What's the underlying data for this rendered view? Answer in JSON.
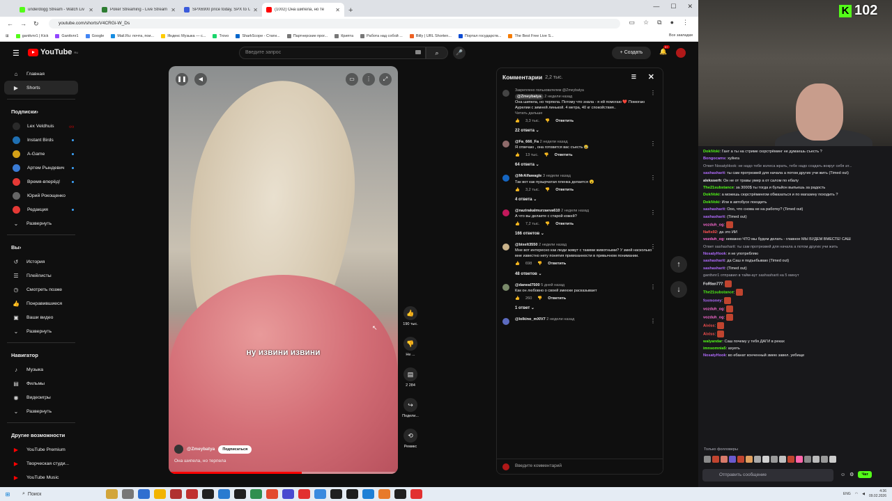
{
  "browser": {
    "tabs": [
      {
        "label": "underdogg Stream - Watch Liv",
        "color": "#53fc18",
        "active": false
      },
      {
        "label": "Poker Streaming - Live Stream",
        "color": "#2e7d32",
        "active": false
      },
      {
        "label": "SPX6900 price today, SPX to U",
        "color": "#3b5bdb",
        "active": false
      },
      {
        "label": "(1002) Она шипела, но те",
        "color": "#ff0000",
        "active": true
      }
    ],
    "url": "youtube.com/shorts/V4CRGi-W_Ds",
    "bookmarks": [
      {
        "label": "ganttvnr1 | Kick",
        "color": "#53fc18"
      },
      {
        "label": "Ganttvnr1",
        "color": "#9146ff"
      },
      {
        "label": "Google",
        "color": "#4285f4"
      },
      {
        "label": "Mail.Ru: почта, пои...",
        "color": "#168de2"
      },
      {
        "label": "Яндекс Музыка — с...",
        "color": "#ffcc00"
      },
      {
        "label": "Trovo",
        "color": "#19d66b"
      },
      {
        "label": "SharkScope - Стати...",
        "color": "#0066cc"
      },
      {
        "label": "Партнерские прог...",
        "color": "#777777"
      },
      {
        "label": "Крипта",
        "color": "#777777"
      },
      {
        "label": "Работа над собой ...",
        "color": "#777777"
      },
      {
        "label": "Bitly | URL Shorten...",
        "color": "#ee6123"
      },
      {
        "label": "Портал государств...",
        "color": "#0d4cd3"
      },
      {
        "label": "The Best Free Live S...",
        "color": "#f57c00"
      }
    ],
    "all_bookmarks": "Все закладки"
  },
  "header": {
    "logo": "YouTube",
    "logo_region": "RU",
    "search_placeholder": "Введите запрос",
    "create_label": "Создать",
    "notif_count": "9+"
  },
  "sidebar": {
    "main": [
      {
        "label": "Главная",
        "icon": "home-icon",
        "glyph": "⌂"
      },
      {
        "label": "Shorts",
        "icon": "shorts-icon",
        "glyph": "▶"
      }
    ],
    "subs_title": "Подписки",
    "subs": [
      {
        "label": "Lex Veldhuis",
        "color": "#2a2a2a",
        "badge": "live"
      },
      {
        "label": "Instant Birds",
        "color": "#1f6fb2",
        "badge": "dot"
      },
      {
        "label": "A-Game",
        "color": "#d4a017",
        "badge": "dot"
      },
      {
        "label": "Артем Рындевич",
        "color": "#3a7bd5",
        "badge": "dot"
      },
      {
        "label": "Время-вперёд!",
        "color": "#e53935",
        "badge": "dot"
      },
      {
        "label": "Юрий Рокощенко",
        "color": "#666666",
        "badge": ""
      },
      {
        "label": "Редакция",
        "color": "#e53935",
        "badge": "dot"
      }
    ],
    "expand_label": "Развернуть",
    "you_title": "Вы",
    "you": [
      {
        "label": "История",
        "icon": "history-icon",
        "glyph": "↺"
      },
      {
        "label": "Плейлисты",
        "icon": "playlists-icon",
        "glyph": "☰"
      },
      {
        "label": "Смотреть позже",
        "icon": "watch-later-icon",
        "glyph": "◷"
      },
      {
        "label": "Понравившиеся",
        "icon": "like-icon",
        "glyph": "👍"
      },
      {
        "label": "Ваши видео",
        "icon": "your-videos-icon",
        "glyph": "▣"
      }
    ],
    "nav_title": "Навигатор",
    "nav": [
      {
        "label": "Музыка",
        "icon": "music-icon",
        "glyph": "♪"
      },
      {
        "label": "Фильмы",
        "icon": "films-icon",
        "glyph": "▤"
      },
      {
        "label": "Видеоигры",
        "icon": "games-icon",
        "glyph": "◉"
      }
    ],
    "more_title": "Другие возможности",
    "more": [
      {
        "label": "YouTube Premium",
        "color": "#ff0000"
      },
      {
        "label": "Творческая студи...",
        "color": "#ff0000"
      },
      {
        "label": "YouTube Music",
        "color": "#ff0000"
      },
      {
        "label": "YouTube Детям",
        "color": "#ff0000"
      }
    ]
  },
  "video": {
    "caption": "ну извини извини",
    "channel": "@Zmeybatya",
    "subscribe": "Подписаться",
    "title": "Она шипела, но терпела",
    "progress": 0.58
  },
  "actions": [
    {
      "name": "like-button",
      "icon": "thumbs-up-icon",
      "glyph": "👍",
      "label": "190 тыс."
    },
    {
      "name": "dislike-button",
      "icon": "thumbs-down-icon",
      "glyph": "👎",
      "label": "Не ..."
    },
    {
      "name": "comments-button",
      "icon": "comment-icon",
      "glyph": "▤",
      "label": "2 284"
    },
    {
      "name": "share-button",
      "icon": "share-icon",
      "glyph": "↪",
      "label": "Подели..."
    },
    {
      "name": "remix-button",
      "icon": "remix-icon",
      "glyph": "⟲",
      "label": "Ремикс"
    }
  ],
  "comments": {
    "title": "Комментарии",
    "count": "2,2 тыс.",
    "reply_label": "Ответить",
    "input_placeholder": "Введите комментарий",
    "items": [
      {
        "pinned": "Закреплено пользователем @Zmeybatya",
        "author": "@Zmeybatya",
        "time": "2 недели назад",
        "text": "Она шипела, но терпела. Потому что знала - я ей помогаю ❤️ Помогаю Аурелии с зимней линькой. 4 метра, 40 кг спокойствия..",
        "more": "Читать дальше",
        "likes": "3,3 тыс.",
        "replies": "22 ответа",
        "color": "#444444"
      },
      {
        "author": "@Fa_666_Fa",
        "time": "2 недели назад",
        "text": "Я отвечаю , она готовится вас съесть 😂",
        "likes": "13 тыс.",
        "replies": "64 ответа",
        "color": "#8e6a6a"
      },
      {
        "author": "@MrAlfawagle",
        "time": "3 недели назад",
        "text": "Так вот как пузырчатая пленка делается 😮",
        "likes": "3,2 тыс.",
        "replies": "4 ответа",
        "color": "#1565c0"
      },
      {
        "author": "@nazirakalmurzaeva610",
        "time": "2 недели назад",
        "text": "А что вы делаете с старой кожей?",
        "likes": "7,2 тыс.",
        "replies": "166 ответов",
        "color": "#c2185b"
      },
      {
        "author": "@bixelt3550",
        "time": "2 недели назад",
        "text": "Мне вот интересно как люди живут с такими животными? У змей насколько мне известно нету понятия привязанности в привычном понимании.",
        "likes": "698",
        "replies": "48 ответов",
        "color": "#c9b28a"
      },
      {
        "author": "@daneal7500",
        "time": "5 дней назад",
        "text": "Как он любовно о своей змеюке расказывает",
        "likes": "260",
        "replies": "1 ответ",
        "color": "#7a8a6a"
      },
      {
        "author": "@lolkino_mXIV7",
        "time": "2 недели назад",
        "text": "",
        "likes": "",
        "replies": "",
        "color": "#5c6bc0"
      }
    ]
  },
  "overlay": {
    "viewers": "102",
    "chat": [
      {
        "user": "DokiVoki",
        "color": "#53fc18",
        "text": "Гант а ты на стриме сюрстрёминг не думаешь съесть ?"
      },
      {
        "user": "Bongocams",
        "color": "#b36cff",
        "text": "хуйнга"
      },
      {
        "user": "",
        "color": "#adadb8",
        "text": "Ответ NosatyHook: не надо тебе колеса жрать, тебе надо создать вокруг себя ат..."
      },
      {
        "user": "sashasharit",
        "color": "#b36cff",
        "text": "ты сам протрезвей для начала а потом других учи жить (Timed out)"
      },
      {
        "user": "aleksserh",
        "color": "#efeff1",
        "text": "Он не от травы умер а от салом по ебалу"
      },
      {
        "user": "The21substance",
        "color": "#53fc18",
        "text": "за 3000$ ты тогда и бульйон выпьешь за радость"
      },
      {
        "user": "DokiVoki",
        "color": "#53fc18",
        "text": "а можешь сюрстрёмингом обмазаться и по магазину походить ?"
      },
      {
        "user": "DokiVoki",
        "color": "#53fc18",
        "text": "Или в автобусе поездить"
      },
      {
        "user": "sashasharit",
        "color": "#b36cff",
        "text": "Ооо, что снова не на работку? (Timed out)"
      },
      {
        "user": "sashasharit",
        "color": "#b36cff",
        "text": "(Timed out)"
      },
      {
        "user": "vozduh_og",
        "color": "#ff6cd6",
        "text": ""
      },
      {
        "user": "Nafis92",
        "color": "#ff5252",
        "text": "да это ИИ"
      },
      {
        "user": "vozduh_og",
        "color": "#ff6cd6",
        "text": "неважно ЧТО мы будем делать - главное МЫ БУДЕМ ВМЕСТЕ! САШ"
      },
      {
        "user": "",
        "color": "#adadb8",
        "text": "Ответ sashasharit: ты сам протрезвей для начала а потом других учи жить"
      },
      {
        "user": "NosatyHook",
        "color": "#b36cff",
        "text": "я не употребляю"
      },
      {
        "user": "sashasharit",
        "color": "#b36cff",
        "text": "да Саш я подъебываю (Timed out)"
      },
      {
        "user": "sashasharit",
        "color": "#b36cff",
        "text": "(Timed out)"
      },
      {
        "user": "",
        "color": "#adadb8",
        "text": "ganttvnr1 отправил в тайм-аут sashasharit на 5 минут"
      },
      {
        "user": "FoRlan777",
        "color": "#efeff1",
        "text": ""
      },
      {
        "user": "The21substance",
        "color": "#53fc18",
        "text": ""
      },
      {
        "user": "foxmoney",
        "color": "#b36cff",
        "text": ""
      },
      {
        "user": "vozduh_og",
        "color": "#ff6cd6",
        "text": ""
      },
      {
        "user": "vozduh_og",
        "color": "#ff6cd6",
        "text": ""
      },
      {
        "user": "Aixiss",
        "color": "#ff5252",
        "text": ""
      },
      {
        "user": "Aixiss",
        "color": "#ff5252",
        "text": ""
      },
      {
        "user": "walyandar",
        "color": "#53fc18",
        "text": "Саш почему у тебя ДАГИ в реках"
      },
      {
        "user": "imnsomnia5",
        "color": "#53fc18",
        "text": "ахуеть"
      },
      {
        "user": "NosatyHook",
        "color": "#b36cff",
        "text": "во ебанат конченный змею завел. уебище"
      }
    ],
    "followers_only": "Только фолловеры",
    "input_placeholder": "Отправить сообщение",
    "send_label": "Чат"
  },
  "taskbar": {
    "search": "Поиск",
    "lang": "ENG",
    "time": "4:36",
    "date": "09.02.2026"
  }
}
